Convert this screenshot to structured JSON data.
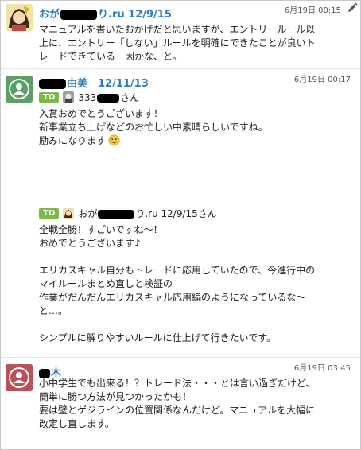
{
  "messages": [
    {
      "sender_pre": "おが",
      "sender_post": "り.ru 12/9/15",
      "time": "6月19日 00:15",
      "lines": [
        "マニュアルを書いたおかげだと思いますが、エントリールール以",
        "上に、エントリー「しない」ルールを明確にできたことが良いト",
        "レードできている一因かな、と。"
      ]
    },
    {
      "sender_pre": "",
      "sender_post": "由美　12/11/13",
      "time": "6月19日 00:17",
      "to1": {
        "badge": "TO",
        "name_pre": "333",
        "name_post": "さん"
      },
      "lines1": [
        "入賞おめでとうございます！",
        "新事業立ち上げなどのお忙しい中素晴らしいですね。",
        "励みになります"
      ],
      "to2": {
        "badge": "TO",
        "name_pre": "おが",
        "name_post": "り.ru 12/9/15さん"
      },
      "lines2": [
        "全戦全勝！すごいですね～！",
        "おめでとうございます♪",
        "",
        "エリカスキャル自分もトレードに応用していたので、今進行中の",
        "マイルールまとめ直しと検証の",
        "作業がだんだんエリカスキャル応用編のようになっているな～",
        "と…。",
        "",
        "シンプルに解りやすいルールに仕上げて行きたいです。"
      ]
    },
    {
      "sender_pre": "",
      "sender_post": "木",
      "time": "6月19日 03:45",
      "lines": [
        "小中学生でも出来る！？トレード法・・・とは言い過ぎだけど、",
        "簡単に勝つ方法が見つかったかも！",
        "要は壁とゲジラインの位置関係なんだけど。マニュアルを大幅に",
        "改定し直します。"
      ]
    }
  ],
  "colors": {
    "sender": "#2a7bbf",
    "to_badge": "#7bb848",
    "default_avatar_green": "#5aa068",
    "default_avatar_red": "#b9505a"
  }
}
